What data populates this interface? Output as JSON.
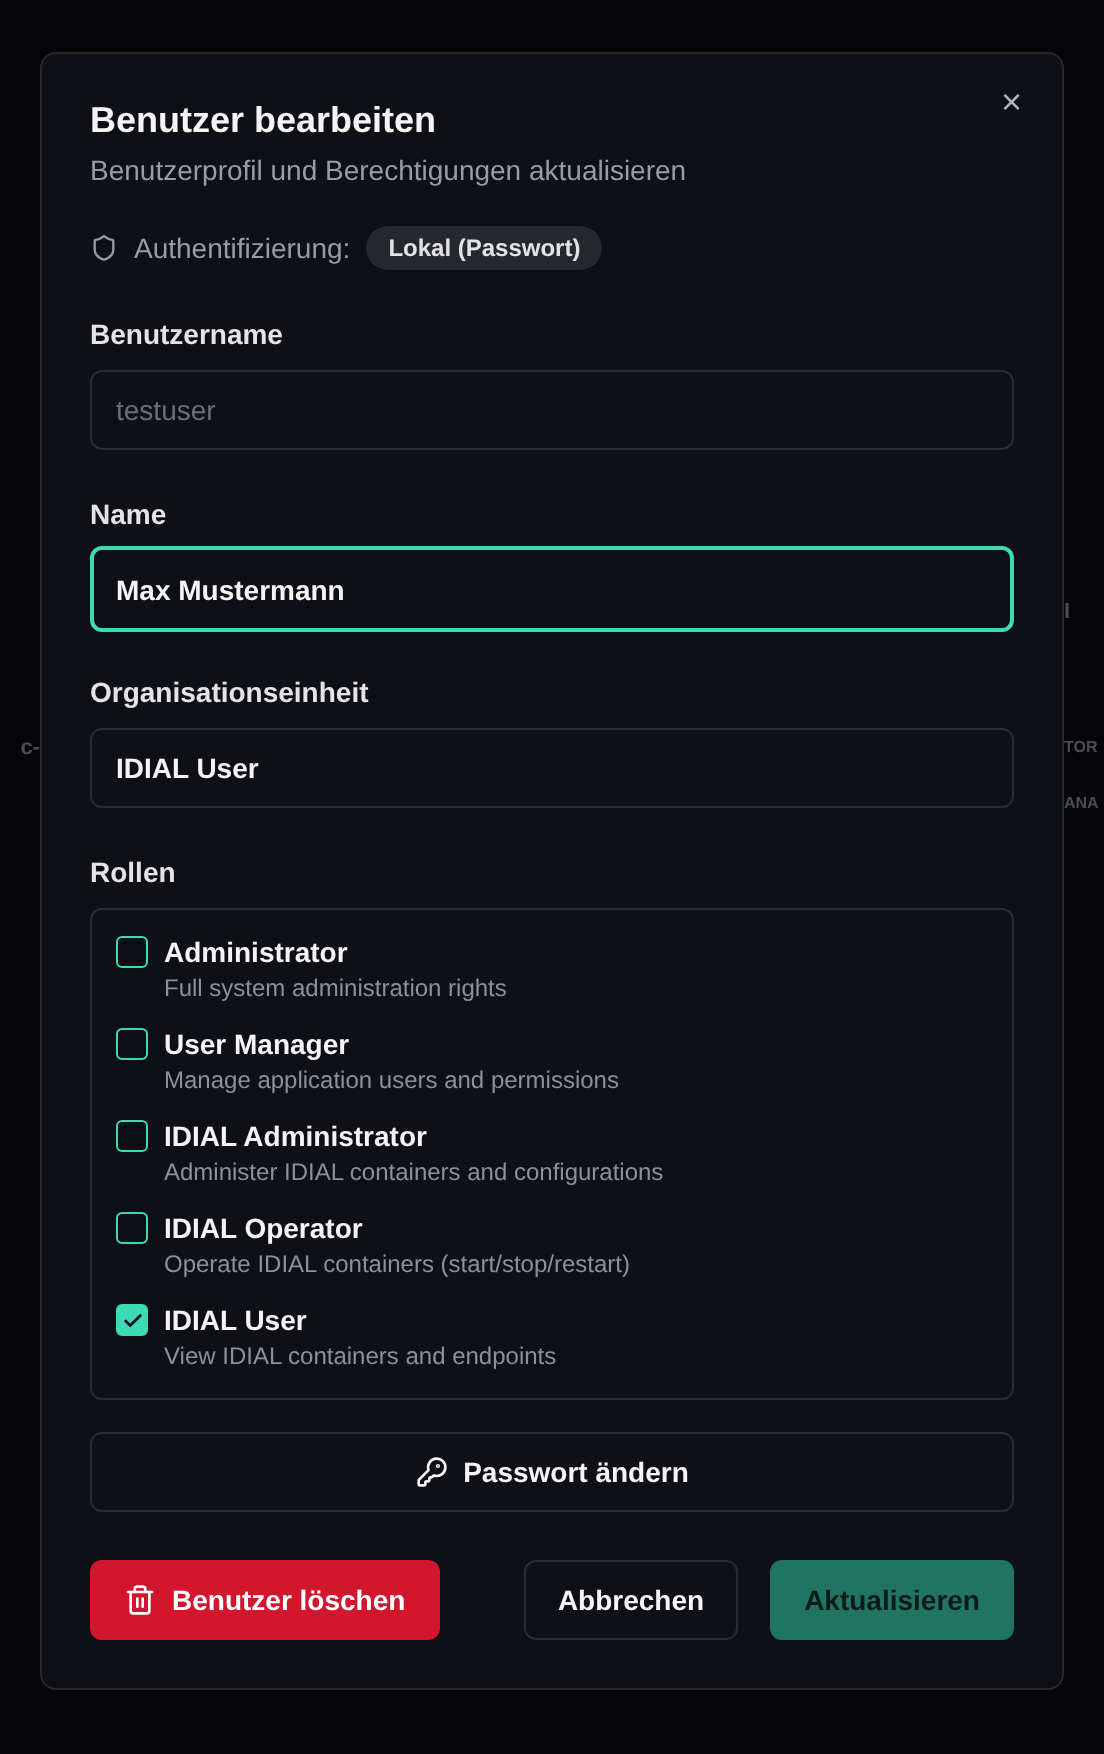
{
  "background": {
    "left_texts": [
      "c-"
    ],
    "right_texts": [
      "I",
      "TOR",
      "ANA"
    ]
  },
  "dialog": {
    "title": "Benutzer bearbeiten",
    "subtitle": "Benutzerprofil und Berechtigungen aktualisieren",
    "close": "×",
    "auth": {
      "label": "Authentifizierung:",
      "badge": "Lokal (Passwort)"
    },
    "fields": [
      {
        "label": "Benutzername",
        "value": "testuser",
        "disabled": true,
        "focused": false
      },
      {
        "label": "Name",
        "value": "Max Mustermann",
        "disabled": false,
        "focused": true
      },
      {
        "label": "Organisationseinheit",
        "value": "IDIAL User",
        "disabled": false,
        "focused": false
      }
    ],
    "roles_label": "Rollen",
    "roles": [
      {
        "name": "Administrator",
        "description": "Full system administration rights",
        "checked": false
      },
      {
        "name": "User Manager",
        "description": "Manage application users and permissions",
        "checked": false
      },
      {
        "name": "IDIAL Administrator",
        "description": "Administer IDIAL containers and configurations",
        "checked": false
      },
      {
        "name": "IDIAL Operator",
        "description": "Operate IDIAL containers (start/stop/restart)",
        "checked": false
      },
      {
        "name": "IDIAL User",
        "description": "View IDIAL containers and endpoints",
        "checked": true
      }
    ],
    "password_button": "Passwort ändern",
    "buttons": [
      {
        "kind": "danger",
        "label": "Benutzer löschen"
      },
      {
        "kind": "outline",
        "label": "Abbrechen"
      },
      {
        "kind": "primary",
        "label": "Aktualisieren"
      }
    ]
  }
}
